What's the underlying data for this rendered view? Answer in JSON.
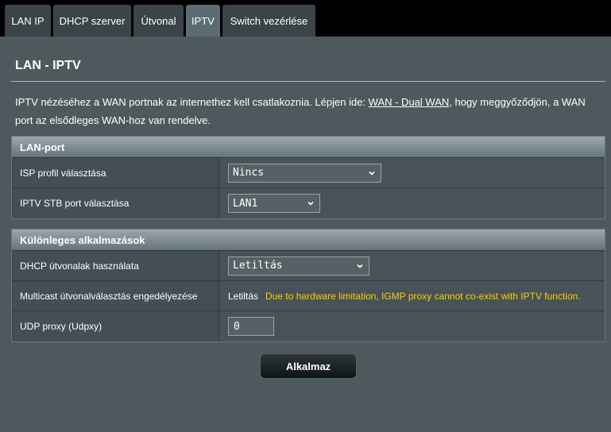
{
  "tabs": [
    {
      "label": "LAN IP"
    },
    {
      "label": "DHCP szerver"
    },
    {
      "label": "Útvonal"
    },
    {
      "label": "IPTV"
    },
    {
      "label": "Switch vezérlése"
    }
  ],
  "page": {
    "title": "LAN - IPTV",
    "desc_before": "IPTV nézéséhez a WAN portnak az internethez kell csatlakoznia. Lépjen ide: ",
    "desc_link": "WAN - Dual WAN",
    "desc_after": ", hogy meggyőződjön, a WAN port az elsődleges WAN-hoz van rendelve."
  },
  "lan_port": {
    "header": "LAN-port",
    "isp_profile": {
      "label": "ISP profil választása",
      "value": "Nincs"
    },
    "stb_port": {
      "label": "IPTV STB port választása",
      "value": "LAN1"
    }
  },
  "special": {
    "header": "Különleges alkalmazások",
    "dhcp_routes": {
      "label": "DHCP útvonalak használata",
      "value": "Letiltás"
    },
    "multicast": {
      "label": "Multicast útvonalválasztás engedélyezése",
      "value": "Letiltás",
      "warning": "Due to hardware limitation, IGMP proxy cannot co-exist with IPTV function."
    },
    "udp_proxy": {
      "label": "UDP proxy (Udpxy)",
      "value": "0"
    }
  },
  "apply_label": "Alkalmaz",
  "icons": {
    "dropdown": "chevron-down-icon"
  },
  "colors": {
    "warning": "#ffcc00",
    "panel": "#4d595d",
    "active_tab": "#5c6c73"
  }
}
